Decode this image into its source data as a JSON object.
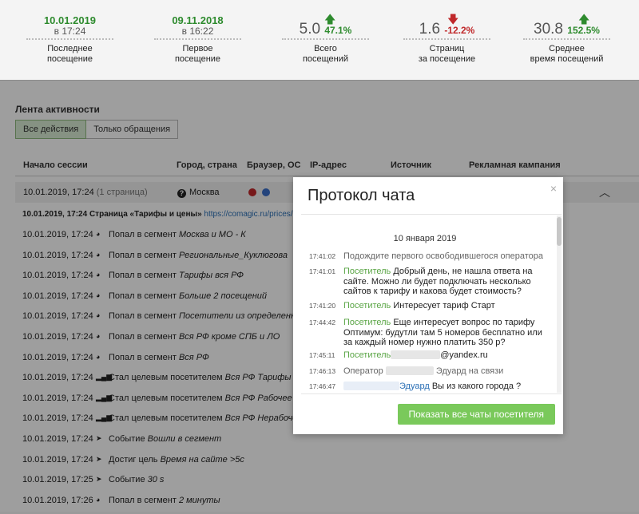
{
  "stats": [
    {
      "v1": "10.01.2019",
      "v2": "в 17:24",
      "label1": "Последнее",
      "label2": "посещение"
    },
    {
      "v1": "09.11.2018",
      "v2": "в 16:22",
      "label1": "Первое",
      "label2": "посещение"
    }
  ],
  "metrics": [
    {
      "value": "5.0",
      "pct": "47.1%",
      "dir": "up",
      "label1": "Всего",
      "label2": "посещений"
    },
    {
      "value": "1.6",
      "pct": "-12.2%",
      "dir": "down",
      "label1": "Страниц",
      "label2": "за посещение"
    },
    {
      "value": "30.8",
      "pct": "152.5%",
      "dir": "up",
      "label1": "Среднее",
      "label2": "время посещений"
    }
  ],
  "activity": {
    "title": "Лента активности",
    "filters": [
      "Все действия",
      "Только обращения"
    ]
  },
  "table": {
    "headers": [
      "Начало сессии",
      "Город, страна",
      "Браузер, ОС",
      "IP-адрес",
      "Источник",
      "Рекламная кампания"
    ],
    "session": {
      "start": "10.01.2019, 17:24",
      "pages": "(1 страница)",
      "city": "Москва"
    },
    "page_row": {
      "text": "10.01.2019, 17:24 Страница «Тарифы и цены»",
      "url": "https://comagic.ru/prices/"
    }
  },
  "events": [
    {
      "time": "10.01.2019, 17:24",
      "icon": "◕",
      "action": "Попал в сегмент",
      "detail": "Москва и МО - К"
    },
    {
      "time": "10.01.2019, 17:24",
      "icon": "◕",
      "action": "Попал в сегмент",
      "detail": "Региональные_Куклюгова"
    },
    {
      "time": "10.01.2019, 17:24",
      "icon": "◕",
      "action": "Попал в сегмент",
      "detail": "Тарифы вся РФ"
    },
    {
      "time": "10.01.2019, 17:24",
      "icon": "◕",
      "action": "Попал в сегмент",
      "detail": "Больше 2 посещений"
    },
    {
      "time": "10.01.2019, 17:24",
      "icon": "◕",
      "action": "Попал в сегмент",
      "detail": "Посетители из определенно"
    },
    {
      "time": "10.01.2019, 17:24",
      "icon": "◕",
      "action": "Попал в сегмент",
      "detail": "Вся РФ кроме СПБ и ЛО"
    },
    {
      "time": "10.01.2019, 17:24",
      "icon": "◕",
      "action": "Попал в сегмент",
      "detail": "Вся РФ"
    },
    {
      "time": "10.01.2019, 17:24",
      "icon": "▂▄▆",
      "action": "Стал целевым посетителем",
      "detail": "Вся РФ Тарифы"
    },
    {
      "time": "10.01.2019, 17:24",
      "icon": "▂▄▆",
      "action": "Стал целевым посетителем",
      "detail": "Вся РФ Рабочее вр"
    },
    {
      "time": "10.01.2019, 17:24",
      "icon": "▂▄▆",
      "action": "Стал целевым посетителем",
      "detail": "Вся РФ Нерабоче"
    },
    {
      "time": "10.01.2019, 17:24",
      "icon": "➤",
      "action": "Событие",
      "detail": "Вошли в сегмент"
    },
    {
      "time": "10.01.2019, 17:24",
      "icon": "➤",
      "action": "Достиг цель",
      "detail": "Время на сайте >5с"
    },
    {
      "time": "10.01.2019, 17:25",
      "icon": "➤",
      "action": "Событие",
      "detail": "30 s"
    },
    {
      "time": "10.01.2019, 17:26",
      "icon": "◕",
      "action": "Попал в сегмент",
      "detail": "2 минуты"
    }
  ],
  "modal": {
    "title": "Протокол чата",
    "close": "×",
    "date": "10 января 2019",
    "messages": [
      {
        "time": "17:41:02",
        "who": "",
        "text": "Подождите первого освободившегося оператора"
      },
      {
        "time": "17:41:01",
        "who": "Посетитель",
        "text": "Добрый день, не нашла ответа на сайте. Можно ли будет подключать несколько сайтов к тарифу и какова будет стоимость?"
      },
      {
        "time": "17:41:20",
        "who": "Посетитель",
        "text": "Интересует тариф Старт"
      },
      {
        "time": "17:44:42",
        "who": "Посетитель",
        "text": "Еще интересует вопрос по тарифу Оптимум: будутли там 5 номеров бесплатно или за каждый номер нужно платить 350 р?"
      },
      {
        "time": "17:45:11",
        "who": "Посетитель",
        "text": "@yandex.ru"
      },
      {
        "time": "17:46:13",
        "who": "Оператор",
        "text": "Эдуард на связи"
      },
      {
        "time": "17:46:47",
        "who": "Эдуард",
        "text": "Вы из какого города ?"
      }
    ],
    "button": "Показать все чаты посетителя"
  }
}
